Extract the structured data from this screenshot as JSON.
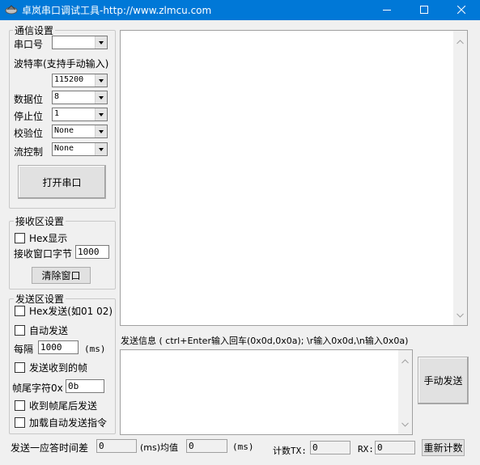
{
  "window": {
    "title": "卓岚串口调试工具-http://www.zlmcu.com",
    "controls": {
      "minimize": "minimize-icon",
      "maximize": "maximize-icon",
      "close": "close-icon"
    }
  },
  "comm": {
    "group_title": "通信设置",
    "port_label": "串口号",
    "port_value": "",
    "baud_label": "波特率(支持手动输入)",
    "baud_value": "115200",
    "databits_label": "数据位",
    "databits_value": "8",
    "stopbits_label": "停止位",
    "stopbits_value": "1",
    "parity_label": "校验位",
    "parity_value": "None",
    "flow_label": "流控制",
    "flow_value": "None",
    "open_button": "打开串口"
  },
  "recv": {
    "group_title": "接收区设置",
    "hex_display_label": "Hex显示",
    "window_bytes_label": "接收窗口字节",
    "window_bytes_value": "1000",
    "clear_button": "清除窗口"
  },
  "send": {
    "group_title": "发送区设置",
    "hex_send_label": "Hex发送(如01 02)",
    "auto_send_label": "自动发送",
    "interval_label": "每隔",
    "interval_value": "1000",
    "interval_unit": "(ms)",
    "echo_frame_label": "发送收到的帧",
    "frame_tail_label": "帧尾字符0x",
    "frame_tail_value": "0b",
    "send_after_tail_label": "收到帧尾后发送",
    "load_auto_cmds_label": "加载自动发送指令"
  },
  "send_info": {
    "hint": "发送信息 ( ctrl+Enter输入回车(0x0d,0x0a); \\r输入0x0d,\\n输入0x0a)",
    "manual_send_button": "手动发送"
  },
  "status": {
    "response_label": "发送一应答时间差",
    "response_value": "0",
    "avg_unit_label": "(ms)均值",
    "avg_value": "0",
    "ms_label": "(ms)",
    "tx_label": "计数TX:",
    "tx_value": "0",
    "rx_label": "RX:",
    "rx_value": "0",
    "reset_button": "重新计数"
  }
}
